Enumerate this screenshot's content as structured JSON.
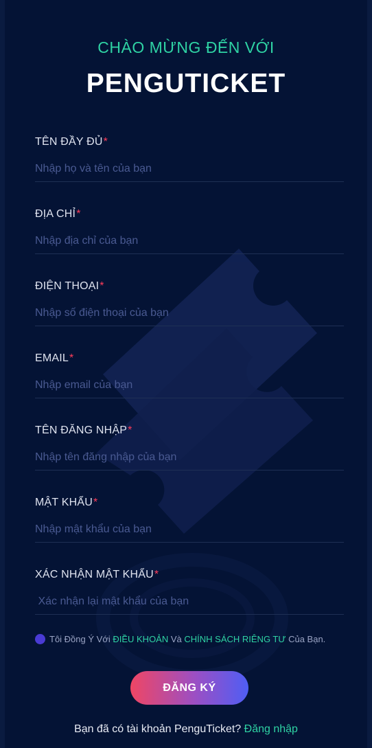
{
  "header": {
    "welcome": "CHÀO MỪNG ĐẾN VỚI",
    "brand": "PENGUTICKET"
  },
  "form": {
    "required_mark": "*",
    "fields": [
      {
        "label": "TÊN ĐẦY ĐỦ",
        "placeholder": "Nhập họ và tên của bạn",
        "value": ""
      },
      {
        "label": "ĐỊA CHỈ",
        "placeholder": "Nhập địa chỉ của bạn",
        "value": ""
      },
      {
        "label": "ĐIỆN THOẠI",
        "placeholder": "Nhập số điện thoại của bạn",
        "value": ""
      },
      {
        "label": "EMAIL",
        "placeholder": "Nhập email của bạn",
        "value": ""
      },
      {
        "label": "TÊN ĐĂNG NHẬP",
        "placeholder": "Nhập tên đăng nhập của bạn",
        "value": ""
      },
      {
        "label": "MẬT KHẨU",
        "placeholder": "Nhập mật khẩu của bạn",
        "value": ""
      },
      {
        "label": "XÁC NHẬN MẬT KHẨU",
        "placeholder": " Xác nhận lại mật khẩu của bạn",
        "value": ""
      }
    ],
    "terms": {
      "prefix": "Tôi Đồng Ý Với ",
      "terms_link": "ĐIỀU KHOẢN",
      "middle": " Và ",
      "privacy_link": "CHÍNH SÁCH RIÊNG TƯ",
      "suffix": " Của Bạn."
    },
    "submit_label": "ĐĂNG KÝ"
  },
  "footer": {
    "question": "Bạn đã có tài khoản PenguTicket? ",
    "login_link": "Đăng nhập"
  },
  "colors": {
    "background": "#041335",
    "accent_green": "#2fd3a4",
    "required_red": "#ff3d5a",
    "button_gradient_start": "#ef4664",
    "button_gradient_end": "#4f5ef4"
  }
}
